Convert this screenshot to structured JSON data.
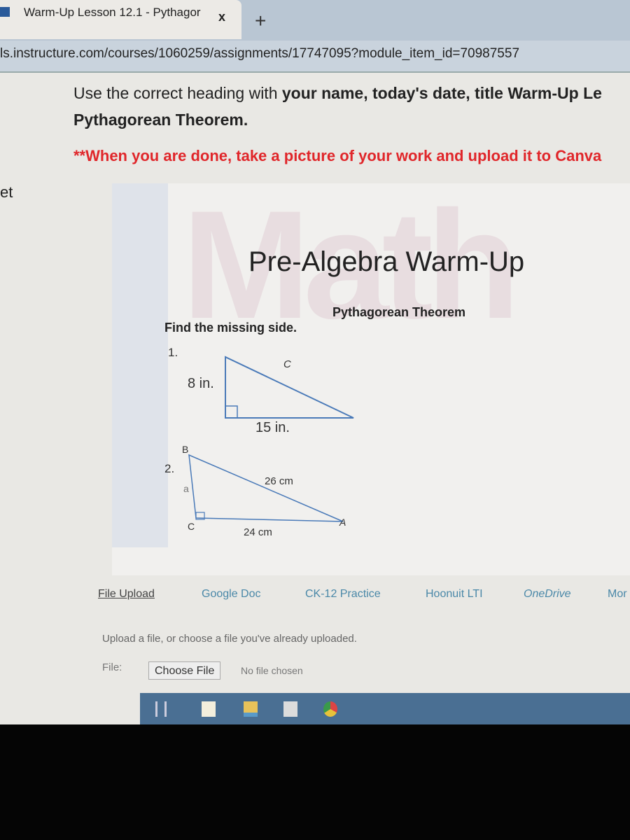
{
  "browser": {
    "tab_title": "Warm-Up Lesson 12.1 - Pythagor",
    "close": "x",
    "new_tab": "+",
    "url": "ls.instructure.com/courses/1060259/assignments/17747095?module_item_id=70987557"
  },
  "instructions": {
    "line1_a": "Use the correct heading with ",
    "line1_b": "your name, today's date, title Warm-Up Le",
    "line2": "Pythagorean Theorem.",
    "note": "**When you are done, take a picture of your work and upload it to Canva"
  },
  "sidebar": {
    "fragment": "et"
  },
  "worksheet": {
    "watermark": "Math",
    "title": "Pre-Algebra Warm-Up",
    "subtitle": "Pythagorean Theorem",
    "prompt": "Find the missing side.",
    "problems": [
      {
        "number": "1.",
        "leg_vertical": "8 in.",
        "leg_horizontal": "15 in.",
        "hypotenuse": "C"
      },
      {
        "number": "2.",
        "vertex_top": "B",
        "vertex_right_angle": "C",
        "vertex_right": "A",
        "leg_vertical": "a",
        "hypotenuse": "26 cm",
        "leg_horizontal": "24 cm"
      }
    ]
  },
  "submission": {
    "tabs": [
      {
        "label": "File Upload",
        "active": true
      },
      {
        "label": "Google Doc"
      },
      {
        "label": "CK-12 Practice"
      },
      {
        "label": "Hoonuit LTI"
      },
      {
        "label": "OneDrive"
      },
      {
        "label": "Mor"
      }
    ],
    "hint": "Upload a file, or choose a file you've already uploaded.",
    "file_label": "File:",
    "choose_button": "Choose File",
    "no_file": "No file chosen"
  },
  "taskbar": {
    "icons": [
      "task-view-icon",
      "file-icon",
      "file-explorer-icon",
      "store-icon",
      "chrome-icon"
    ]
  },
  "colors": {
    "note_red": "#e0262a",
    "link": "#4a88a8",
    "taskbar": "#4a6f93"
  }
}
